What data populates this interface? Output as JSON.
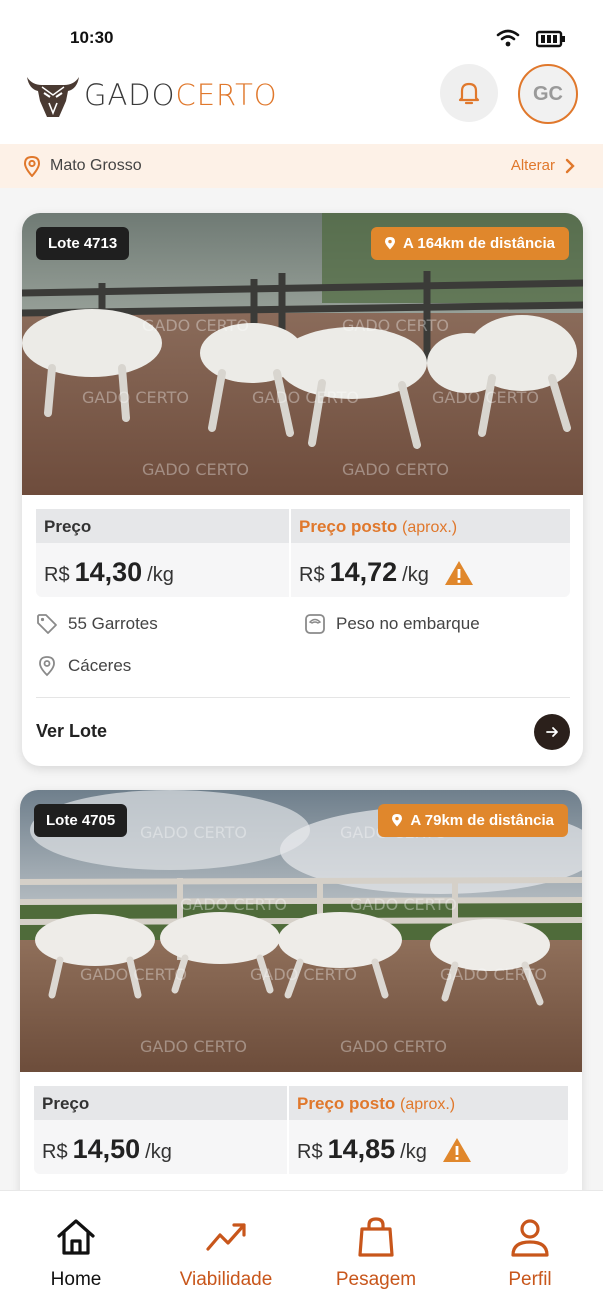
{
  "status_bar": {
    "time": "10:30"
  },
  "header": {
    "logo_part1": "GADO",
    "logo_part2": "CERTO",
    "avatar_initials": "GC"
  },
  "location": {
    "name": "Mato Grosso",
    "change_label": "Alterar"
  },
  "lots": [
    {
      "lot_label": "Lote 4713",
      "distance": "A 164km de distância",
      "price_header": "Preço",
      "price_currency": "R$",
      "price_value": "14,30",
      "price_unit": "/kg",
      "posted_header": "Preço posto",
      "posted_approx": "(aprox.)",
      "posted_currency": "R$",
      "posted_value": "14,72",
      "posted_unit": "/kg",
      "animals": "55 Garrotes",
      "weight_info": "Peso no embarque",
      "city": "Cáceres",
      "view_label": "Ver Lote"
    },
    {
      "lot_label": "Lote 4705",
      "distance": "A 79km de distância",
      "price_header": "Preço",
      "price_currency": "R$",
      "price_value": "14,50",
      "price_unit": "/kg",
      "posted_header": "Preço posto",
      "posted_approx": "(aprox.)",
      "posted_currency": "R$",
      "posted_value": "14,85",
      "posted_unit": "/kg"
    }
  ],
  "bottom_nav": [
    {
      "label": "Home",
      "icon": "home-icon",
      "active": true
    },
    {
      "label": "Viabilidade",
      "icon": "trend-icon",
      "active": false
    },
    {
      "label": "Pesagem",
      "icon": "bag-icon",
      "active": false
    },
    {
      "label": "Perfil",
      "icon": "user-icon",
      "active": false
    }
  ],
  "colors": {
    "accent": "#e0782c",
    "nav_accent": "#c8561b",
    "location_bg": "#fdf1e7"
  }
}
